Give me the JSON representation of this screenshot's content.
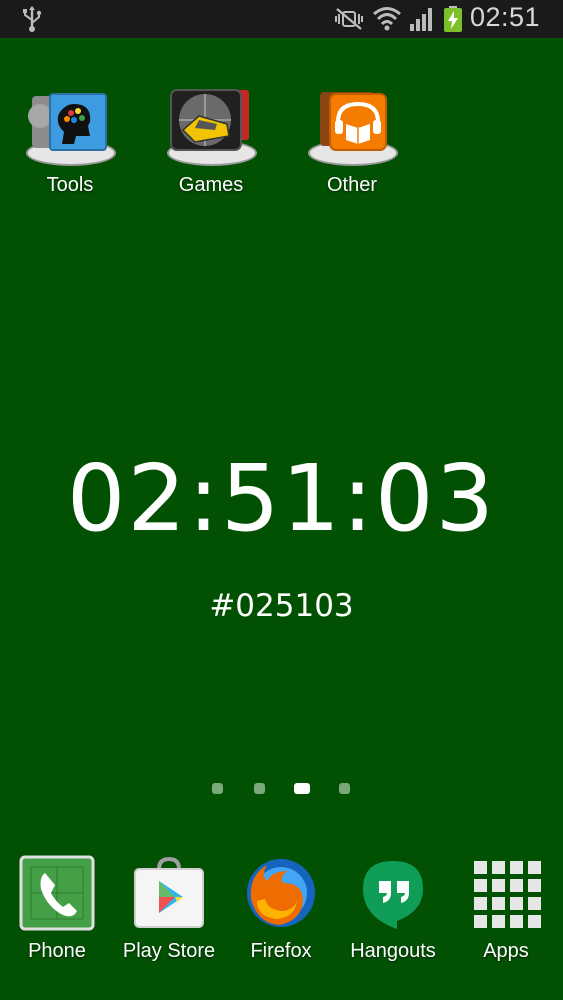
{
  "status_bar": {
    "time": "02:51"
  },
  "folders": [
    {
      "label": "Tools"
    },
    {
      "label": "Games"
    },
    {
      "label": "Other"
    }
  ],
  "clock": {
    "time": "02:51:03",
    "hex": "#025103"
  },
  "page_indicator": {
    "count": 4,
    "active_index": 2
  },
  "dock": [
    {
      "label": "Phone"
    },
    {
      "label": "Play Store"
    },
    {
      "label": "Firefox"
    },
    {
      "label": "Hangouts"
    },
    {
      "label": "Apps"
    }
  ],
  "colors": {
    "background": "#025103",
    "status_bar": "#1a1a1a"
  }
}
